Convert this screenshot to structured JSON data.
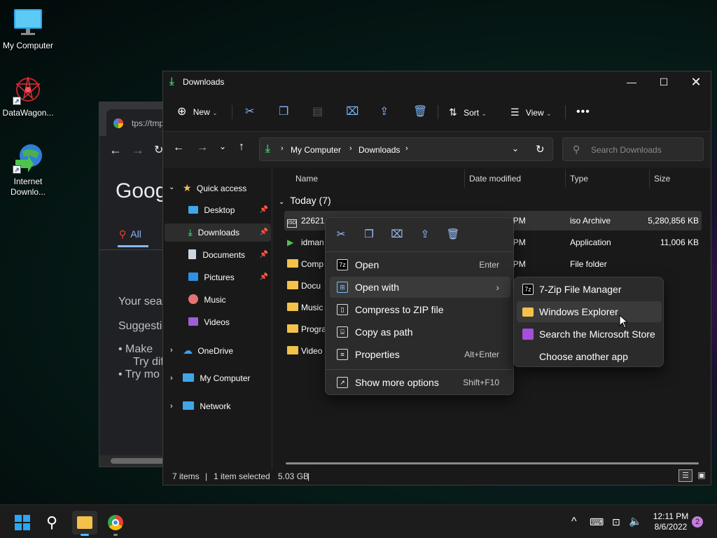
{
  "desktop": {
    "icons": [
      {
        "label": "My Computer"
      },
      {
        "label": "DataWagon..."
      },
      {
        "label": "Internet Downlo..."
      }
    ]
  },
  "browser": {
    "tab_url": "tps://tmp",
    "google": "Goog",
    "all_tab": "All",
    "text_lines": [
      "Your sea",
      "Suggesti"
    ],
    "bullets": [
      "Make",
      "Try dif",
      "Try mo"
    ]
  },
  "explorer": {
    "title": "Downloads",
    "toolbar": {
      "new": "New",
      "sort": "Sort",
      "view": "View"
    },
    "breadcrumb": [
      "My Computer",
      "Downloads"
    ],
    "search_placeholder": "Search Downloads",
    "nav": {
      "quick_access": "Quick access",
      "items": [
        {
          "label": "Desktop",
          "pinned": true
        },
        {
          "label": "Downloads",
          "pinned": true
        },
        {
          "label": "Documents",
          "pinned": true
        },
        {
          "label": "Pictures",
          "pinned": true
        },
        {
          "label": "Music",
          "pinned": false
        },
        {
          "label": "Videos",
          "pinned": false
        }
      ],
      "onedrive": "OneDrive",
      "my_computer": "My Computer",
      "network": "Network"
    },
    "columns": [
      "Name",
      "Date modified",
      "Type",
      "Size"
    ],
    "group": "Today (7)",
    "rows": [
      {
        "name": "22621.1...",
        "date": "...08 PM",
        "type": "iso Archive",
        "size": "5,280,856 KB"
      },
      {
        "name": "idman",
        "date": "...00 PM",
        "type": "Application",
        "size": "11,006 KB"
      },
      {
        "name": "Comp",
        "date": "...01 PM",
        "type": "File folder",
        "size": ""
      },
      {
        "name": "Docu",
        "date": "",
        "type": "",
        "size": ""
      },
      {
        "name": "Music",
        "date": "",
        "type": "",
        "size": ""
      },
      {
        "name": "Progra",
        "date": "",
        "type": "",
        "size": ""
      },
      {
        "name": "Video",
        "date": "",
        "type": "",
        "size": ""
      }
    ],
    "status": {
      "items": "7 items",
      "selected": "1 item selected",
      "size": "5.03 GB"
    }
  },
  "context_menu": {
    "items": [
      {
        "label": "Open",
        "shortcut": "Enter"
      },
      {
        "label": "Open with",
        "shortcut": ""
      },
      {
        "label": "Compress to ZIP file",
        "shortcut": ""
      },
      {
        "label": "Copy as path",
        "shortcut": ""
      },
      {
        "label": "Properties",
        "shortcut": "Alt+Enter"
      }
    ],
    "more": {
      "label": "Show more options",
      "shortcut": "Shift+F10"
    }
  },
  "submenu": {
    "items": [
      {
        "label": "7-Zip File Manager"
      },
      {
        "label": "Windows Explorer"
      },
      {
        "label": "Search the Microsoft Store"
      },
      {
        "label": "Choose another app"
      }
    ]
  },
  "taskbar": {
    "time": "12:11 PM",
    "date": "8/6/2022",
    "notifications": "2"
  },
  "colors": {
    "accent": "#4cc2ff",
    "folder": "#f4c14a",
    "download_green": "#3dbf6f"
  }
}
